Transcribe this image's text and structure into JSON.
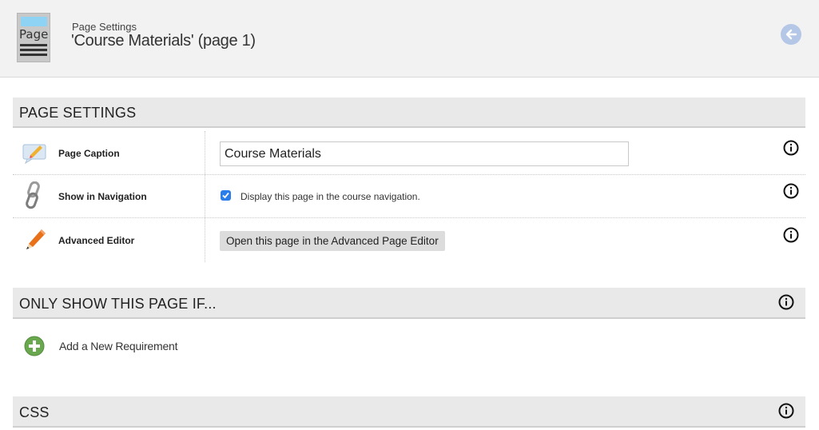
{
  "header": {
    "icon_word": "Page",
    "subtitle": "Page Settings",
    "title": "'Course Materials' (page 1)"
  },
  "sections": {
    "page_settings": {
      "label": "PAGE SETTINGS"
    },
    "only_show": {
      "label": "ONLY SHOW THIS PAGE IF..."
    },
    "css": {
      "label": "CSS"
    }
  },
  "rows": {
    "caption": {
      "label": "Page Caption",
      "value": "Course Materials"
    },
    "navigation": {
      "label": "Show in Navigation",
      "checkbox_text": "Display this page in the course navigation.",
      "checked": true
    },
    "editor": {
      "label": "Advanced Editor",
      "button_label": "Open this page in the Advanced Page Editor"
    }
  },
  "requirements": {
    "add_label": "Add a New Requirement"
  },
  "colors": {
    "accent": "#2b7de9",
    "add_green": "#6aa84f",
    "back_button": "#b5c7e6",
    "pencil_orange": "#e8711a"
  },
  "icons": [
    "page-icon",
    "back-arrow-icon",
    "info-icon",
    "speech-bubble-pencil-icon",
    "chain-link-icon",
    "pencil-icon",
    "plus-circle-icon"
  ]
}
